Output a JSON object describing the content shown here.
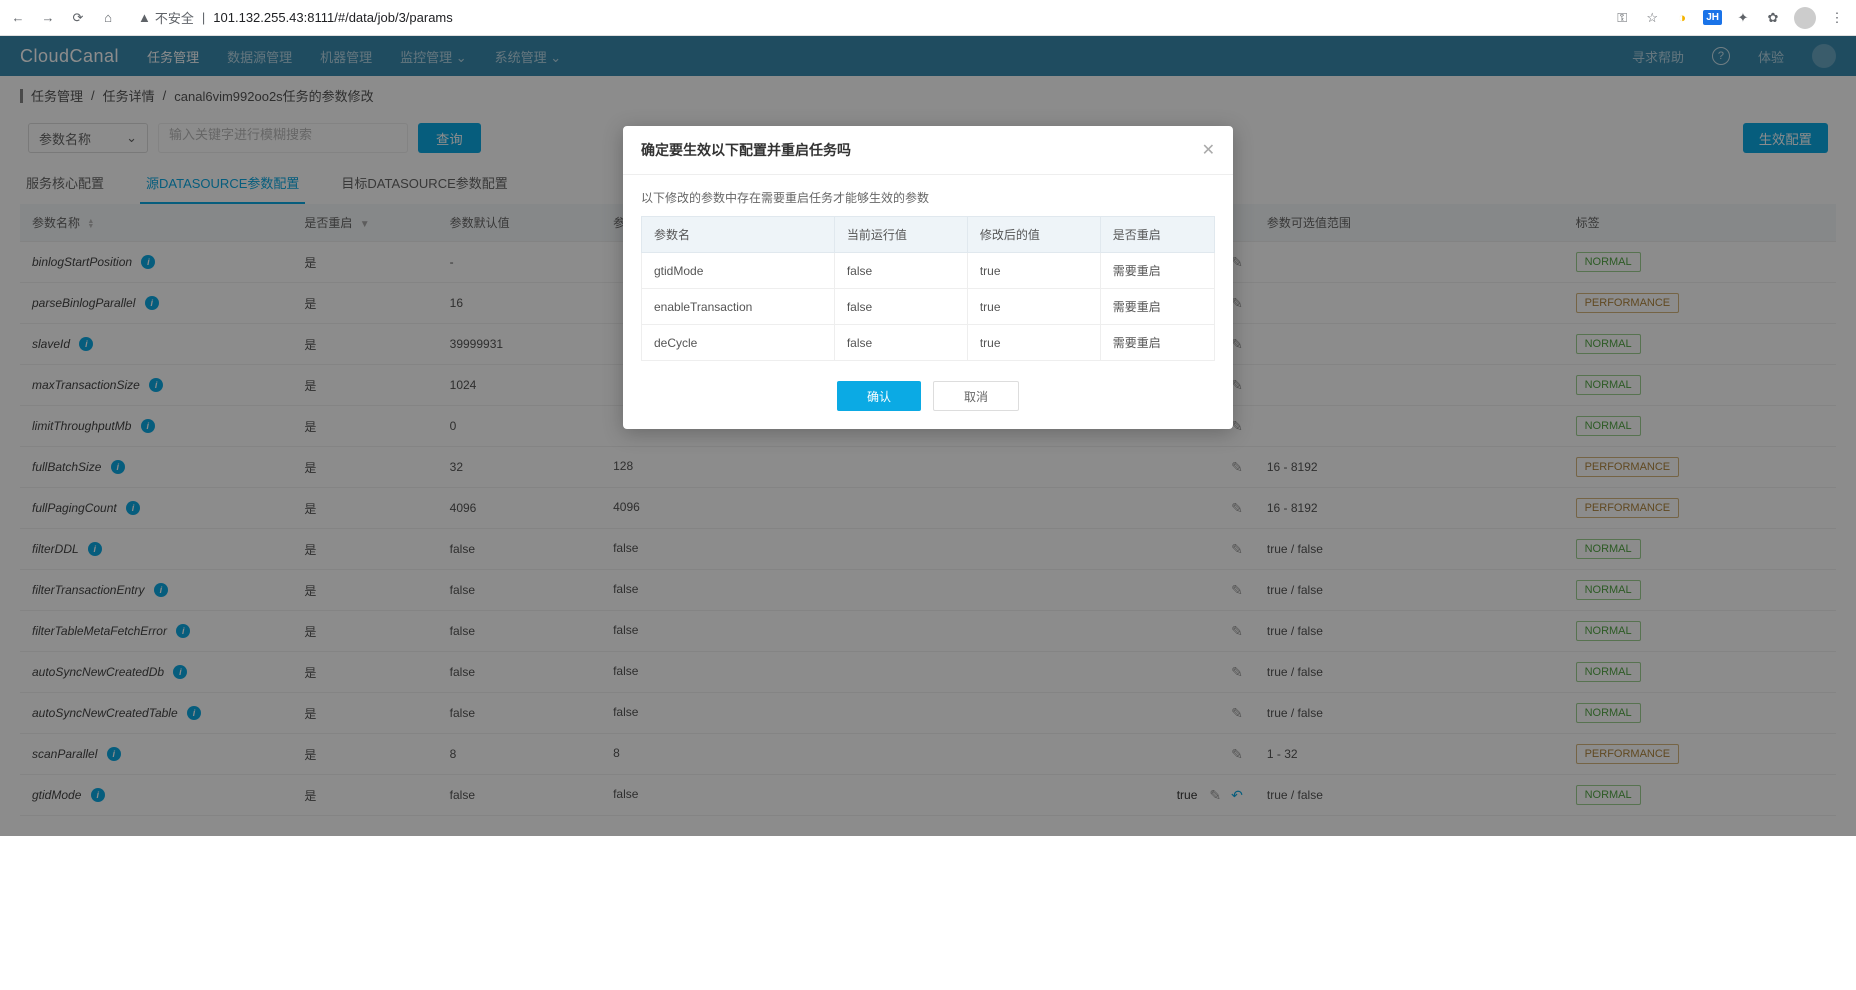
{
  "browser": {
    "insecure_label": "不安全",
    "url": "101.132.255.43:8111/#/data/job/3/params",
    "jh_badge": "JH"
  },
  "nav": {
    "logo": "CloudCanal",
    "items": [
      "任务管理",
      "数据源管理",
      "机器管理",
      "监控管理",
      "系统管理"
    ],
    "help_label": "寻求帮助",
    "trial_label": "体验"
  },
  "breadcrumb": {
    "items": [
      "任务管理",
      "任务详情",
      "canal6vim992oo2s任务的参数修改"
    ]
  },
  "controls": {
    "param_select_label": "参数名称",
    "search_placeholder": "输入关键字进行模糊搜索",
    "search_btn": "查询",
    "apply_btn": "生效配置"
  },
  "tabs": [
    "服务核心配置",
    "源DATASOURCE参数配置",
    "目标DATASOURCE参数配置"
  ],
  "table": {
    "headers": {
      "param": "参数名称",
      "restart": "是否重启",
      "default": "参数默认值",
      "current": "参数当前运行值",
      "range": "参数可选值范围",
      "tag": "标签"
    },
    "rows": [
      {
        "name": "binlogStartPosition",
        "restart": "是",
        "def": "-",
        "cur": "",
        "modified": "",
        "range": "",
        "tag": "NORMAL"
      },
      {
        "name": "parseBinlogParallel",
        "restart": "是",
        "def": "16",
        "cur": "",
        "modified": "",
        "range": "",
        "tag": "PERFORMANCE"
      },
      {
        "name": "slaveId",
        "restart": "是",
        "def": "39999931",
        "cur": "",
        "modified": "",
        "range": "",
        "tag": "NORMAL"
      },
      {
        "name": "maxTransactionSize",
        "restart": "是",
        "def": "1024",
        "cur": "",
        "modified": "",
        "range": "",
        "tag": "NORMAL"
      },
      {
        "name": "limitThroughputMb",
        "restart": "是",
        "def": "0",
        "cur": "",
        "modified": "",
        "range": "",
        "tag": "NORMAL"
      },
      {
        "name": "fullBatchSize",
        "restart": "是",
        "def": "32",
        "cur": "128",
        "modified": "",
        "range": "16 - 8192",
        "tag": "PERFORMANCE"
      },
      {
        "name": "fullPagingCount",
        "restart": "是",
        "def": "4096",
        "cur": "4096",
        "modified": "",
        "range": "16 - 8192",
        "tag": "PERFORMANCE"
      },
      {
        "name": "filterDDL",
        "restart": "是",
        "def": "false",
        "cur": "false",
        "modified": "",
        "range": "true / false",
        "tag": "NORMAL"
      },
      {
        "name": "filterTransactionEntry",
        "restart": "是",
        "def": "false",
        "cur": "false",
        "modified": "",
        "range": "true / false",
        "tag": "NORMAL"
      },
      {
        "name": "filterTableMetaFetchError",
        "restart": "是",
        "def": "false",
        "cur": "false",
        "modified": "",
        "range": "true / false",
        "tag": "NORMAL"
      },
      {
        "name": "autoSyncNewCreatedDb",
        "restart": "是",
        "def": "false",
        "cur": "false",
        "modified": "",
        "range": "true / false",
        "tag": "NORMAL"
      },
      {
        "name": "autoSyncNewCreatedTable",
        "restart": "是",
        "def": "false",
        "cur": "false",
        "modified": "",
        "range": "true / false",
        "tag": "NORMAL"
      },
      {
        "name": "scanParallel",
        "restart": "是",
        "def": "8",
        "cur": "8",
        "modified": "",
        "range": "1 - 32",
        "tag": "PERFORMANCE"
      },
      {
        "name": "gtidMode",
        "restart": "是",
        "def": "false",
        "cur": "false",
        "modified": "true",
        "range": "true / false",
        "tag": "NORMAL"
      }
    ]
  },
  "modal": {
    "title": "确定要生效以下配置并重启任务吗",
    "desc": "以下修改的参数中存在需要重启任务才能够生效的参数",
    "headers": {
      "param": "参数名",
      "current": "当前运行值",
      "modified": "修改后的值",
      "restart": "是否重启"
    },
    "rows": [
      {
        "param": "gtidMode",
        "current": "false",
        "modified": "true",
        "restart": "需要重启"
      },
      {
        "param": "enableTransaction",
        "current": "false",
        "modified": "true",
        "restart": "需要重启"
      },
      {
        "param": "deCycle",
        "current": "false",
        "modified": "true",
        "restart": "需要重启"
      }
    ],
    "confirm": "确认",
    "cancel": "取消"
  }
}
